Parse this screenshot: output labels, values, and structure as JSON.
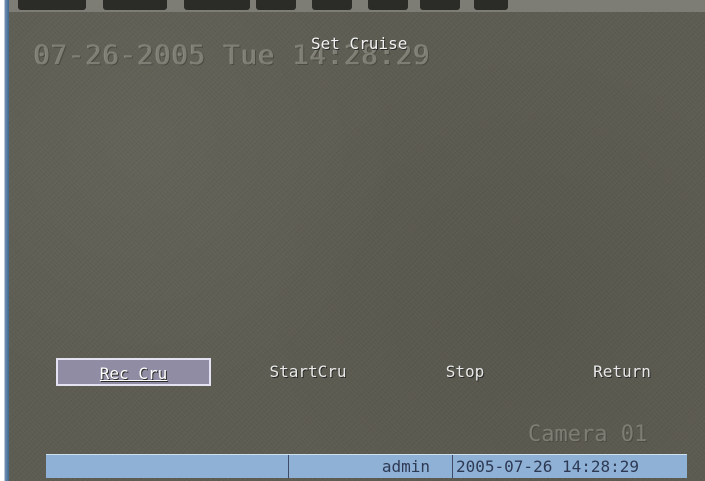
{
  "osd": {
    "timestamp": "07-26-2005 Tue 14:28:29",
    "camera": "Camera 01"
  },
  "menu": {
    "title": "Set Cruise",
    "buttons": [
      {
        "label": "Rec Cru",
        "selected": true
      },
      {
        "label": "StartCru",
        "selected": false
      },
      {
        "label": "Stop",
        "selected": false
      },
      {
        "label": "Return",
        "selected": false
      }
    ]
  },
  "status": {
    "channel": "",
    "user": "admin",
    "datetime": "2005-07-26 14:28:29"
  },
  "colors": {
    "background": "#5d5c52",
    "status_bar": "#8fb1d6",
    "selection_border": "#e4e1f2",
    "selection_fill": "#8f8ca4"
  }
}
